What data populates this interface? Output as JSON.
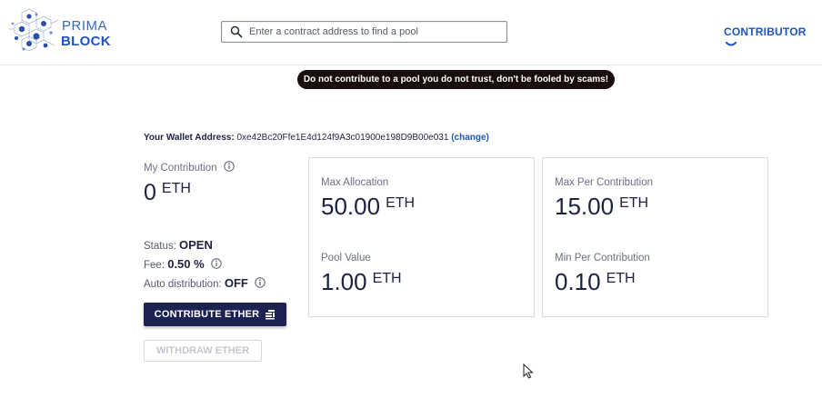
{
  "header": {
    "logo_line1": "PRIMA",
    "logo_line2": "BLOCK",
    "search_placeholder": "Enter a contract address to find a pool",
    "user_menu_label": "CONTRIBUTOR"
  },
  "warning": "Do not contribute to a pool you do not trust, don't be fooled by scams!",
  "wallet": {
    "label": "Your Wallet Address:",
    "address": "0xe42Bc20Ffe1E4d124f9A3c01900e198D9B00e031",
    "change": "(change)"
  },
  "contribution": {
    "label": "My Contribution",
    "value": "0",
    "unit": "ETH"
  },
  "status": {
    "status_label": "Status:",
    "status_value": "OPEN",
    "fee_label": "Fee:",
    "fee_value": "0.50 %",
    "auto_label": "Auto distribution:",
    "auto_value": "OFF"
  },
  "buttons": {
    "contribute": "CONTRIBUTE ETHER",
    "withdraw": "WITHDRAW ETHER"
  },
  "cards": {
    "max_allocation": {
      "label": "Max Allocation",
      "value": "50.00",
      "unit": "ETH"
    },
    "pool_value": {
      "label": "Pool Value",
      "value": "1.00",
      "unit": "ETH"
    },
    "max_per": {
      "label": "Max Per Contribution",
      "value": "15.00",
      "unit": "ETH"
    },
    "min_per": {
      "label": "Min Per Contribution",
      "value": "0.10",
      "unit": "ETH"
    }
  },
  "colors": {
    "brand_blue": "#1e55b6",
    "dark_navy": "#1c2252",
    "warning_bg": "#1a0d0d"
  }
}
